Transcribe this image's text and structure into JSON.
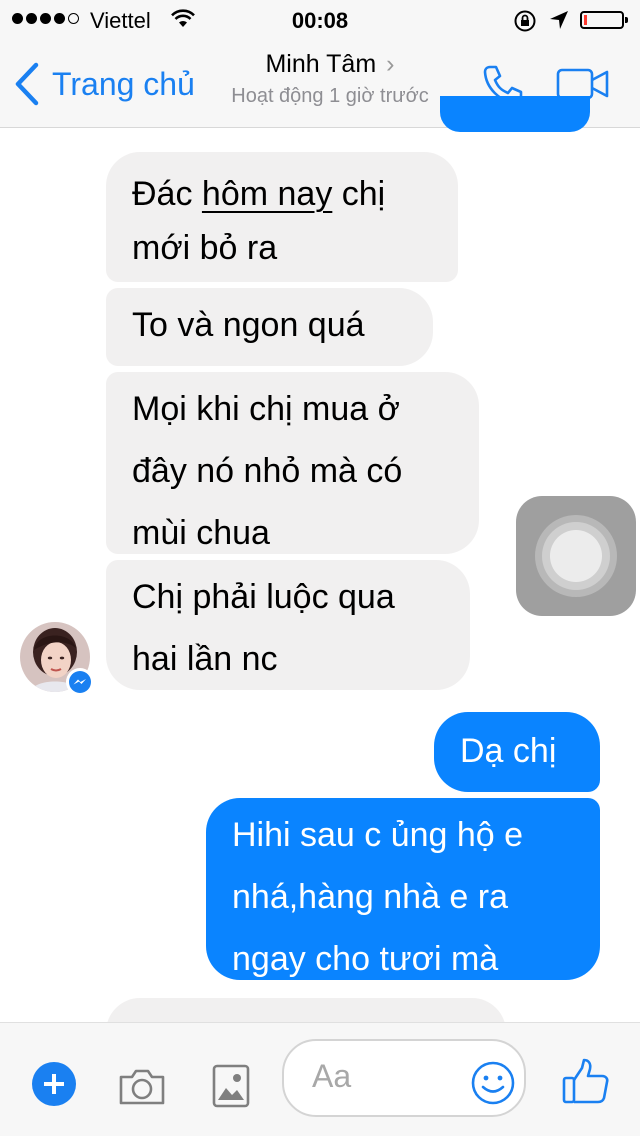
{
  "status_bar": {
    "carrier": "Viettel",
    "time": "00:08"
  },
  "nav": {
    "back_label": "Trang chủ",
    "contact_name": "Minh Tâm",
    "contact_status": "Hoạt động 1 giờ trước"
  },
  "messages": [
    {
      "sender": "contact",
      "lines": [
        "Đác ",
        "hôm nay",
        " chị",
        "mới bỏ ra"
      ]
    },
    {
      "sender": "contact",
      "text": "To và ngon quá"
    },
    {
      "sender": "contact",
      "lines": [
        "Mọi khi chị mua ở",
        "đây nó nhỏ mà có",
        "mùi chua"
      ]
    },
    {
      "sender": "contact",
      "lines": [
        "Chị phải luộc qua",
        "hai lần nc"
      ]
    },
    {
      "sender": "me",
      "text": "Dạ chị"
    },
    {
      "sender": "me",
      "lines": [
        "Hihi sau c ủng hộ e",
        "nhá,hàng nhà e ra",
        "ngay cho tươi mà"
      ]
    }
  ],
  "composer": {
    "placeholder": "Aa"
  },
  "colors": {
    "accent": "#1a80f1",
    "outgoing_bubble": "#0a84ff",
    "incoming_bubble": "#f1f0f0"
  },
  "icons": [
    "back-chevron-icon",
    "phone-icon",
    "video-camera-icon",
    "plus-icon",
    "camera-icon",
    "image-icon",
    "emoji-icon",
    "thumbs-up-icon",
    "messenger-icon",
    "wifi-icon",
    "lock-rotation-icon",
    "location-icon",
    "battery-icon"
  ]
}
